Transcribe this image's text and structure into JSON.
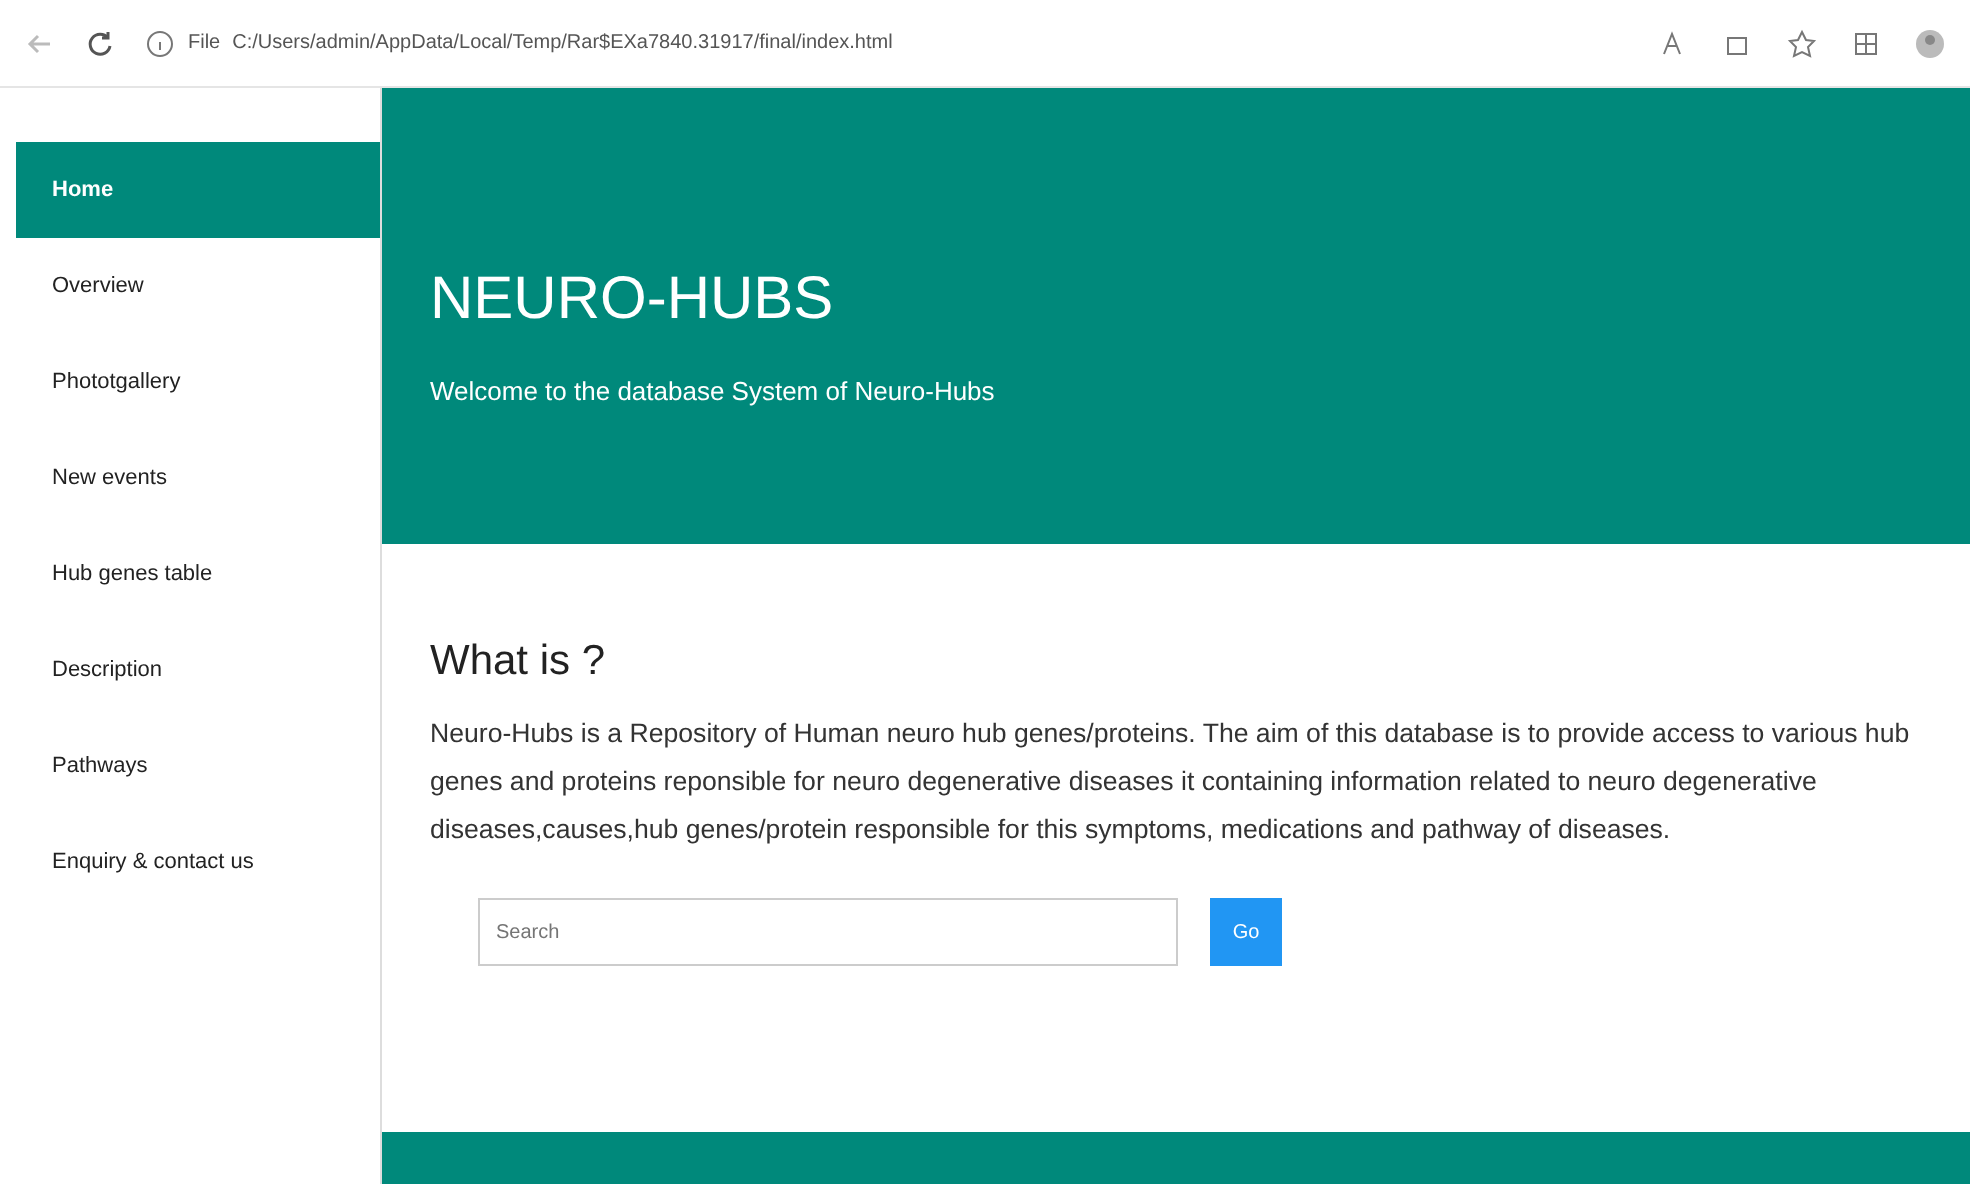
{
  "browser": {
    "file_label": "File",
    "url": "C:/Users/admin/AppData/Local/Temp/Rar$EXa7840.31917/final/index.html"
  },
  "sidebar": {
    "items": [
      {
        "label": "Home",
        "selected": true
      },
      {
        "label": "Overview",
        "selected": false
      },
      {
        "label": "Phototgallery",
        "selected": false
      },
      {
        "label": "New events",
        "selected": false
      },
      {
        "label": "Hub genes table",
        "selected": false
      },
      {
        "label": "Description",
        "selected": false
      },
      {
        "label": "Pathways",
        "selected": false
      },
      {
        "label": "Enquiry & contact us",
        "selected": false
      }
    ]
  },
  "header": {
    "title": "NEURO-HUBS",
    "subtitle": "Welcome to the database System of Neuro-Hubs"
  },
  "about": {
    "heading": "What is ?",
    "text": "Neuro-Hubs is a Repository of Human neuro hub genes/proteins. The aim of this database is to provide access to various hub genes and proteins reponsible for neuro degenerative diseases it containing information related to neuro degenerative diseases,causes,hub genes/protein responsible for this symptoms, medications and pathway of diseases."
  },
  "search": {
    "placeholder": "Search",
    "button": "Go"
  }
}
